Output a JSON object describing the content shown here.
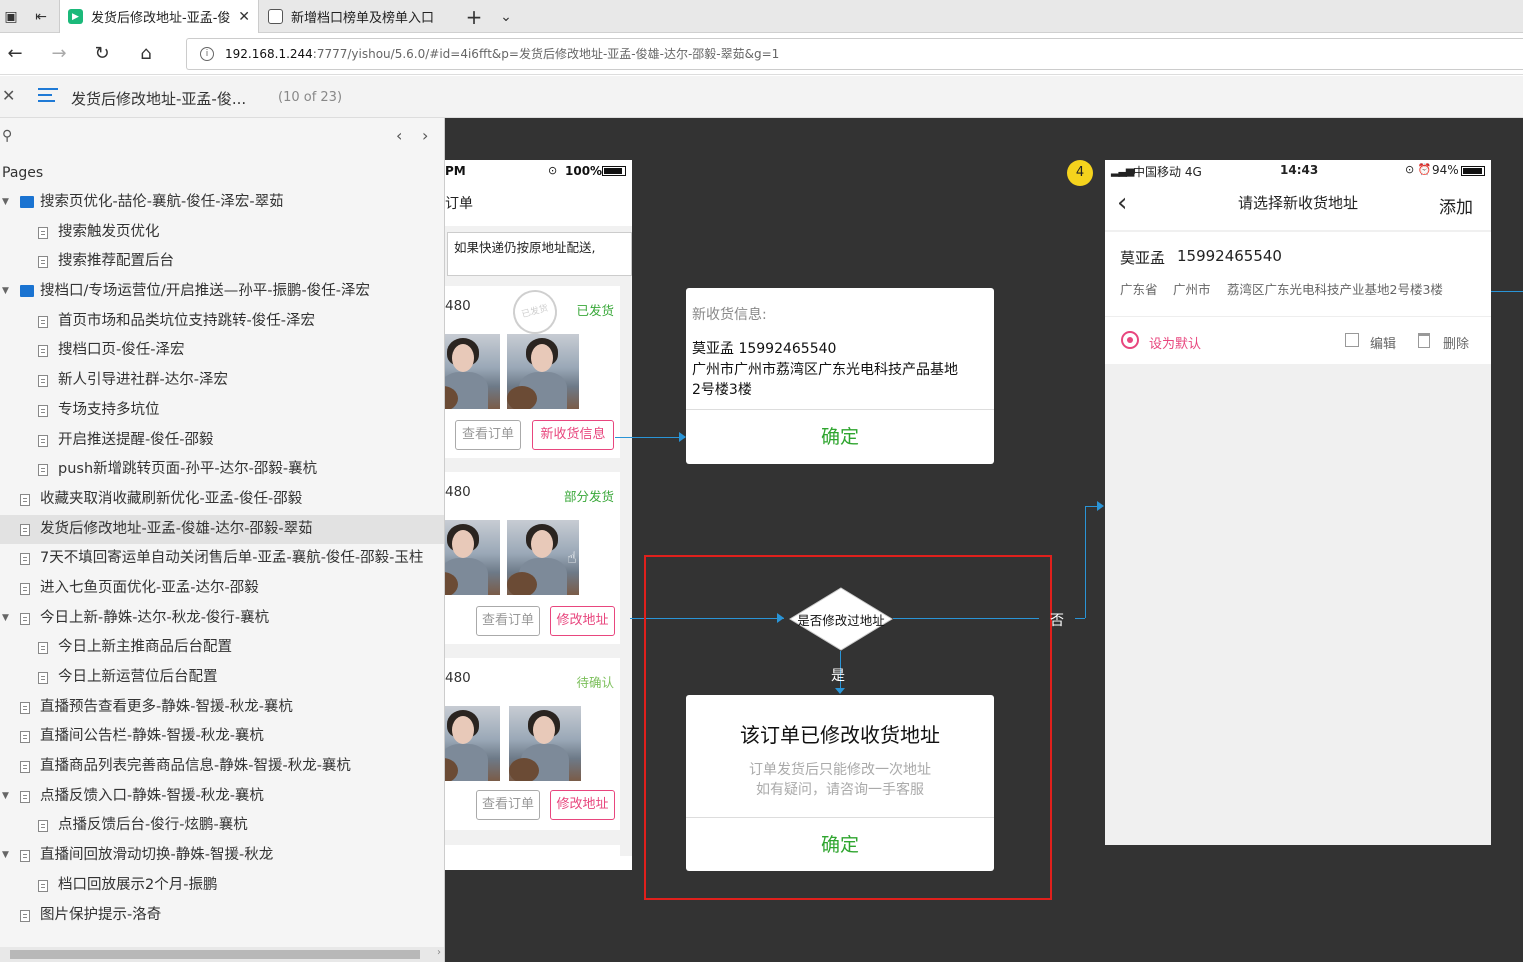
{
  "browser": {
    "tabs": [
      {
        "label": "发货后修改地址-亚孟-俊",
        "active": true
      },
      {
        "label": "新增档口榜单及榜单入口",
        "active": false
      }
    ],
    "new_tab": "+",
    "url_host": "192.168.1.244",
    "url_rest": ":7777/yishou/5.6.0/#id=4i6fft&p=发货后修改地址-亚孟-俊雄-达尔-邵毅-翠茹&g=1"
  },
  "doc": {
    "title": "发货后修改地址-亚孟-俊...",
    "count": "(10 of 23)"
  },
  "sidebar": {
    "pages_label": "Pages",
    "items": [
      {
        "label": "搜索页优化-喆伦-襄航-俊任-泽宏-翠茹",
        "level": 0,
        "type": "folder",
        "expanded": true
      },
      {
        "label": "搜索触发页优化",
        "level": 1,
        "type": "page"
      },
      {
        "label": "搜索推荐配置后台",
        "level": 1,
        "type": "page"
      },
      {
        "label": "搜档口/专场运营位/开启推送—孙平-振鹏-俊任-泽宏",
        "level": 0,
        "type": "folder",
        "expanded": true
      },
      {
        "label": "首页市场和品类坑位支持跳转-俊任-泽宏",
        "level": 1,
        "type": "page"
      },
      {
        "label": "搜档口页-俊任-泽宏",
        "level": 1,
        "type": "page"
      },
      {
        "label": "新人引导进社群-达尔-泽宏",
        "level": 1,
        "type": "page"
      },
      {
        "label": "专场支持多坑位",
        "level": 1,
        "type": "page"
      },
      {
        "label": "开启推送提醒-俊任-邵毅",
        "level": 1,
        "type": "page"
      },
      {
        "label": "push新增跳转页面-孙平-达尔-邵毅-襄杭",
        "level": 1,
        "type": "page"
      },
      {
        "label": "收藏夹取消收藏刷新优化-亚孟-俊任-邵毅",
        "level": 0,
        "type": "page"
      },
      {
        "label": "发货后修改地址-亚孟-俊雄-达尔-邵毅-翠茹",
        "level": 0,
        "type": "page",
        "selected": true
      },
      {
        "label": "7天不填回寄运单自动关闭售后单-亚孟-襄航-俊任-邵毅-玉柱",
        "level": 0,
        "type": "page"
      },
      {
        "label": "进入七鱼页面优化-亚孟-达尔-邵毅",
        "level": 0,
        "type": "page"
      },
      {
        "label": "今日上新-静姝-达尔-秋龙-俊行-襄杭",
        "level": 0,
        "type": "page",
        "expanded": true
      },
      {
        "label": "今日上新主推商品后台配置",
        "level": 1,
        "type": "page"
      },
      {
        "label": "今日上新运营位后台配置",
        "level": 1,
        "type": "page"
      },
      {
        "label": "直播预告查看更多-静姝-智援-秋龙-襄杭",
        "level": 0,
        "type": "page"
      },
      {
        "label": "直播间公告栏-静姝-智援-秋龙-襄杭",
        "level": 0,
        "type": "page"
      },
      {
        "label": "直播商品列表完善商品信息-静姝-智援-秋龙-襄杭",
        "level": 0,
        "type": "page"
      },
      {
        "label": "点播反馈入口-静姝-智援-秋龙-襄杭",
        "level": 0,
        "type": "page",
        "expanded": true
      },
      {
        "label": "点播反馈后台-俊行-炫鹏-襄杭",
        "level": 1,
        "type": "page"
      },
      {
        "label": "直播间回放滑动切换-静姝-智援-秋龙",
        "level": 0,
        "type": "page",
        "expanded": true
      },
      {
        "label": "档口回放展示2个月-振鹏",
        "level": 1,
        "type": "page"
      },
      {
        "label": "图片保护提示-洛奇",
        "level": 0,
        "type": "page"
      }
    ]
  },
  "phone1": {
    "time": "PM",
    "battery": "100%",
    "title": "订单",
    "notice": "如果快递仍按原地址配送,",
    "orders": [
      {
        "id": "480",
        "status": "已发货",
        "status_color": "#3aa83a",
        "btn1": "查看订单",
        "btn2": "新收货信息",
        "stamp": "已发货"
      },
      {
        "id": "480",
        "status": "部分发货",
        "status_color": "#3aa83a",
        "btn1": "查看订单",
        "btn2": "修改地址"
      },
      {
        "id": "480",
        "status": "待确认",
        "status_color": "#7bbf5a",
        "btn1": "查看订单",
        "btn2": "修改地址"
      }
    ]
  },
  "dialog1": {
    "label": "新收货信息:",
    "name_phone": "莫亚孟   15992465540",
    "addr1": "广州市广州市荔湾区广东光电科技产品基地",
    "addr2": "2号楼3楼",
    "ok": "确定"
  },
  "decision": {
    "label": "是否修改过地址",
    "yes": "是",
    "no": "否"
  },
  "dialog2": {
    "title": "该订单已修改收货地址",
    "line1": "订单发货后只能修改一次地址",
    "line2": "如有疑问，请咨询一手客服",
    "ok": "确定"
  },
  "phone2": {
    "badge": "4",
    "carrier": "中国移动  4G",
    "time": "14:43",
    "battery": "94%",
    "title": "请选择新收货地址",
    "add": "添加",
    "name": "莫亚孟",
    "phone": "15992465540",
    "province": "广东省",
    "city": "广州市",
    "detail": "荔湾区广东光电科技产业基地2号楼3楼",
    "default_label": "设为默认",
    "edit": "编辑",
    "delete": "删除",
    "accent": "#e8467e"
  }
}
